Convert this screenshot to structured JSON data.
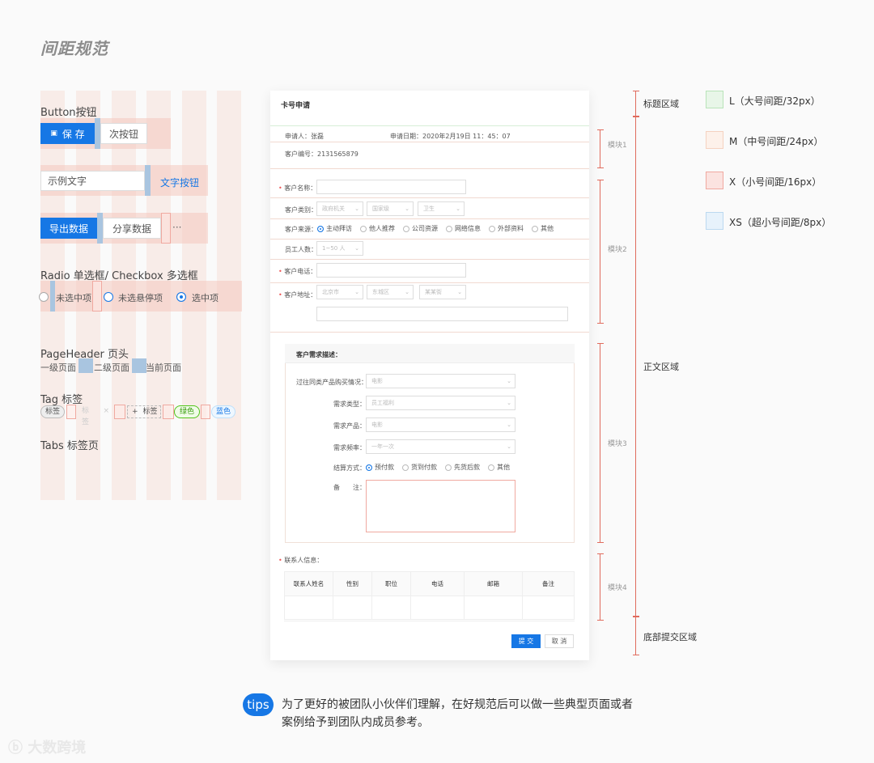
{
  "page": {
    "title": "间距规范"
  },
  "left": {
    "button_title": "Button按钮",
    "save_btn": "保 存",
    "secondary_btn": "次按钮",
    "sample_text": "示例文字",
    "text_btn": "文字按钮",
    "export_btn": "导出数据",
    "share_btn": "分享数据",
    "more": "···",
    "radio_title": "Radio 单选框/ Checkbox 多选框",
    "radio_unselected": "未选中项",
    "radio_hover": "未选悬停项",
    "radio_selected": "选中项",
    "pageheader_title": "PageHeader 页头",
    "level1": "一级页面",
    "level2": "二级页面",
    "current": "当前页面",
    "tag_title": "Tag 标签",
    "tag1": "标签",
    "tag2": "标签",
    "tag2_close": "×",
    "tag3_plus": "+",
    "tag3": "标签",
    "tag_green": "绿色",
    "tag_blue": "蓝色",
    "tabs_title": "Tabs 标签页"
  },
  "form": {
    "title": "卡号申请",
    "applicant": "申请人：张磊",
    "apply_date": "申请日期：2020年2月19日 11：45：07",
    "customer_no": "客户编号：2131565879",
    "customer_name": "客户名称：",
    "customer_type": "客户类别：",
    "type_opts": [
      "政府机关",
      "国家级",
      "卫生"
    ],
    "customer_source": "客户来源：",
    "source_opts": [
      "主动拜访",
      "他人推荐",
      "公司资源",
      "网络信息",
      "外部资料",
      "其他"
    ],
    "employees": "员工人数：",
    "employees_val": "1~50 人",
    "phone": "客户电话：",
    "address": "客户地址：",
    "addr_opts": [
      "北京市",
      "东城区",
      "某某街"
    ],
    "needs_title": "客户需求描述：",
    "past_purchase": "过往同类产品购买情况：",
    "past_val": "电影",
    "need_type": "需求类型：",
    "need_type_val": "员工福利",
    "need_product": "需求产品：",
    "need_product_val": "电影",
    "need_freq": "需求频率：",
    "need_freq_val": "一年一次",
    "settle": "结算方式：",
    "settle_opts": [
      "预付款",
      "货到付款",
      "先货后款",
      "其他"
    ],
    "remark": "备　　注：",
    "contact_title": "联系人信息：",
    "table_headers": [
      "联系人姓名",
      "性别",
      "职位",
      "电话",
      "邮箱",
      "备注"
    ],
    "submit": "提 交",
    "cancel": "取 消"
  },
  "annotations": {
    "title_area": "标题区域",
    "body_area": "正文区域",
    "bottom_area": "底部提交区域",
    "block1": "模块1",
    "block2": "模块2",
    "block3": "模块3",
    "block4": "模块4"
  },
  "legend": {
    "L": "L（大号间距/32px）",
    "M": "M（中号间距/24px）",
    "X": "X（小号间距/16px）",
    "XS": "XS（超小号间距/8px）",
    "colors": {
      "L": "#e8f6e8",
      "M": "#fdf1ea",
      "X": "#fbe3e0",
      "XS": "#e7f2fb"
    }
  },
  "tips": {
    "badge": "tips",
    "text": "为了更好的被团队小伙伴们理解，在好规范后可以做一些典型页面或者案例给予到团队内成员参考。"
  },
  "watermark": "大数跨境"
}
